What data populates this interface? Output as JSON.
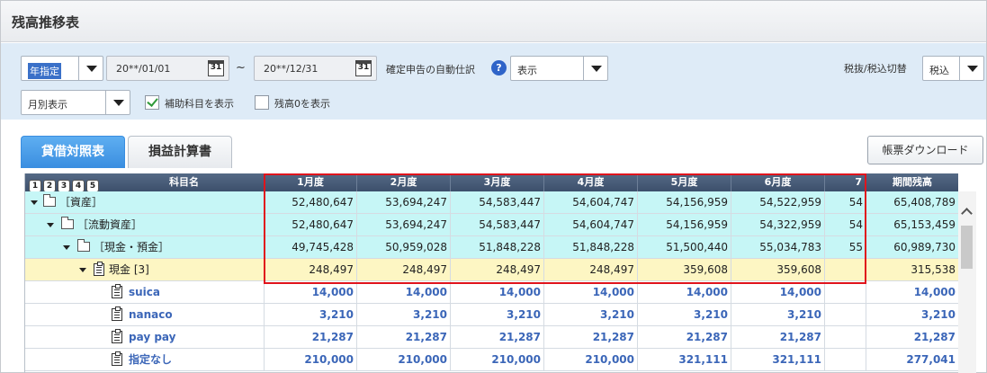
{
  "window": {
    "title": "残高推移表"
  },
  "filters": {
    "period_type": "年指定",
    "date_from": "20**/01/01",
    "date_separator": "~",
    "date_to": "20**/12/31",
    "calendar_icon_text": "31",
    "auto_journal_label": "確定申告の自動仕訳",
    "help_icon_text": "?",
    "auto_journal_value": "表示",
    "tax_label": "税抜/税込切替",
    "tax_value": "税込",
    "display_mode": "月別表示",
    "show_sub_accounts_label": "補助科目を表示",
    "show_sub_accounts_checked": true,
    "show_zero_label": "残高0を表示",
    "show_zero_checked": false
  },
  "tabs": [
    {
      "label": "貸借対照表",
      "active": true
    },
    {
      "label": "損益計算書",
      "active": false
    }
  ],
  "download_button": "帳票ダウンロード",
  "table": {
    "level_buttons": [
      "1",
      "2",
      "3",
      "4",
      "5"
    ],
    "headers": [
      "科目名",
      "1月度",
      "2月度",
      "3月度",
      "4月度",
      "5月度",
      "6月度",
      "7",
      "期間残高"
    ],
    "rows": [
      {
        "label": "［資産］",
        "style": "cyan",
        "icon": "folder",
        "values": [
          "52,480,647",
          "53,694,247",
          "54,583,447",
          "54,604,747",
          "54,156,959",
          "54,522,959",
          "54",
          "65,408,789"
        ]
      },
      {
        "label": "［流動資産］",
        "style": "cyan",
        "icon": "folder",
        "values": [
          "52,480,647",
          "53,694,247",
          "54,583,447",
          "54,604,747",
          "54,156,959",
          "54,322,959",
          "54",
          "65,153,459"
        ]
      },
      {
        "label": "［現金・預金］",
        "style": "cyan",
        "icon": "folder",
        "values": [
          "49,745,428",
          "50,959,028",
          "51,848,228",
          "51,848,228",
          "51,500,440",
          "55,034,783",
          "55",
          "60,989,730"
        ]
      },
      {
        "label": "現金 [3]",
        "style": "yellow",
        "icon": "ledger",
        "values": [
          "248,497",
          "248,497",
          "248,497",
          "248,497",
          "359,608",
          "359,608",
          "",
          "315,538"
        ]
      },
      {
        "label": "suica",
        "style": "white",
        "icon": "ledger",
        "values": [
          "14,000",
          "14,000",
          "14,000",
          "14,000",
          "14,000",
          "14,000",
          "",
          "14,000"
        ]
      },
      {
        "label": "nanaco",
        "style": "white",
        "icon": "ledger",
        "values": [
          "3,210",
          "3,210",
          "3,210",
          "3,210",
          "3,210",
          "3,210",
          "",
          "3,210"
        ]
      },
      {
        "label": "pay pay",
        "style": "white",
        "icon": "ledger",
        "values": [
          "21,287",
          "21,287",
          "21,287",
          "21,287",
          "21,287",
          "21,287",
          "",
          "21,287"
        ]
      },
      {
        "label": "指定なし",
        "style": "white",
        "icon": "ledger",
        "values": [
          "210,000",
          "210,000",
          "210,000",
          "210,000",
          "321,111",
          "321,111",
          "",
          "277,041"
        ]
      }
    ]
  }
}
